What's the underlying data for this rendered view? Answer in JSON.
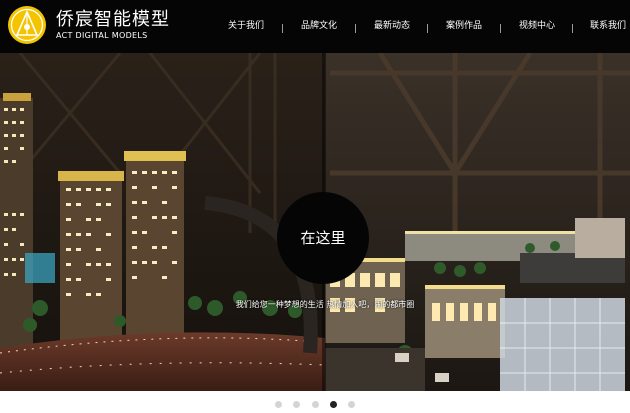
{
  "brand": {
    "name_cn": "侨宸智能模型",
    "name_en": "ACT DIGITAL MODELS",
    "logo_color": "#f5c400"
  },
  "nav": {
    "items": [
      {
        "label": "关于我们"
      },
      {
        "label": "品牌文化"
      },
      {
        "label": "最新动态"
      },
      {
        "label": "案例作品"
      },
      {
        "label": "视频中心"
      },
      {
        "label": "联系我们"
      }
    ]
  },
  "banner": {
    "circle_text": "在这里",
    "slogan": "我们给您一种梦想的生活 热情加入吧，闹的都市圈"
  },
  "slider": {
    "slide_count": 5,
    "active_index": 4
  }
}
